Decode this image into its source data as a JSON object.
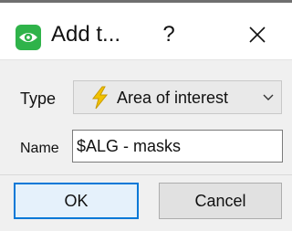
{
  "window": {
    "title": "Add t...",
    "help_label": "?",
    "app_icon": "eye-icon",
    "close_icon": "close-icon"
  },
  "form": {
    "type_label": "Type",
    "type_value": "Area of interest",
    "type_icon": "lightning-bolt-icon",
    "name_label": "Name",
    "name_value": "$ALG - masks"
  },
  "buttons": {
    "ok_label": "OK",
    "cancel_label": "Cancel"
  },
  "colors": {
    "app_icon_green": "#2fb34a",
    "bolt_yellow": "#f2c200",
    "ok_border_blue": "#0078d7"
  }
}
